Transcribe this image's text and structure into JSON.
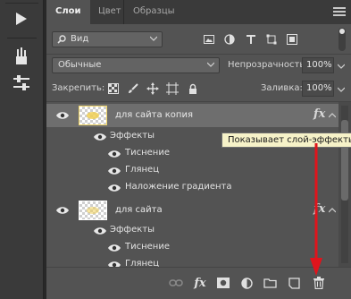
{
  "tabs": [
    {
      "label": "Слои",
      "active": true
    },
    {
      "label": "Цвет",
      "active": false
    },
    {
      "label": "Образцы",
      "active": false
    }
  ],
  "filter": {
    "value": "Вид"
  },
  "blend": {
    "mode": "Обычные",
    "opacity_label": "Непрозрачность:",
    "opacity_value": "100%"
  },
  "lock": {
    "label": "Закрепить:",
    "fill_label": "Заливка:",
    "fill_value": "100%"
  },
  "layers": [
    {
      "name": "для сайта копия",
      "selected": true,
      "effects_label": "Эффекты",
      "effects": [
        "Тиснение",
        "Глянец",
        "Наложение градиента"
      ]
    },
    {
      "name": "для сайта",
      "selected": false,
      "effects_label": "Эффекты",
      "effects": [
        "Тиснение",
        "Глянец"
      ]
    }
  ],
  "fx_symbol": "fx",
  "tooltip": "Показывает слой-эффекты",
  "colors": {
    "panel_bg": "#535353",
    "selected_row": "#6e6e6e",
    "annotation_red": "#e0141c",
    "tooltip_bg": "#f6f2c8"
  },
  "icons": {
    "tools": [
      "play-icon",
      "brushes-icon",
      "sliders-icon"
    ],
    "filter_icons": [
      "image-filter-icon",
      "adjustment-filter-icon",
      "type-filter-icon",
      "shape-filter-icon",
      "smart-object-filter-icon"
    ],
    "lock_icons": [
      "lock-transparent-icon",
      "lock-image-icon",
      "lock-position-icon",
      "lock-artboard-icon",
      "lock-all-icon"
    ],
    "bottom_icons": [
      "link-layers-icon",
      "fx-icon",
      "mask-icon",
      "adjustment-layer-icon",
      "group-folder-icon",
      "new-layer-icon",
      "trash-icon"
    ]
  }
}
